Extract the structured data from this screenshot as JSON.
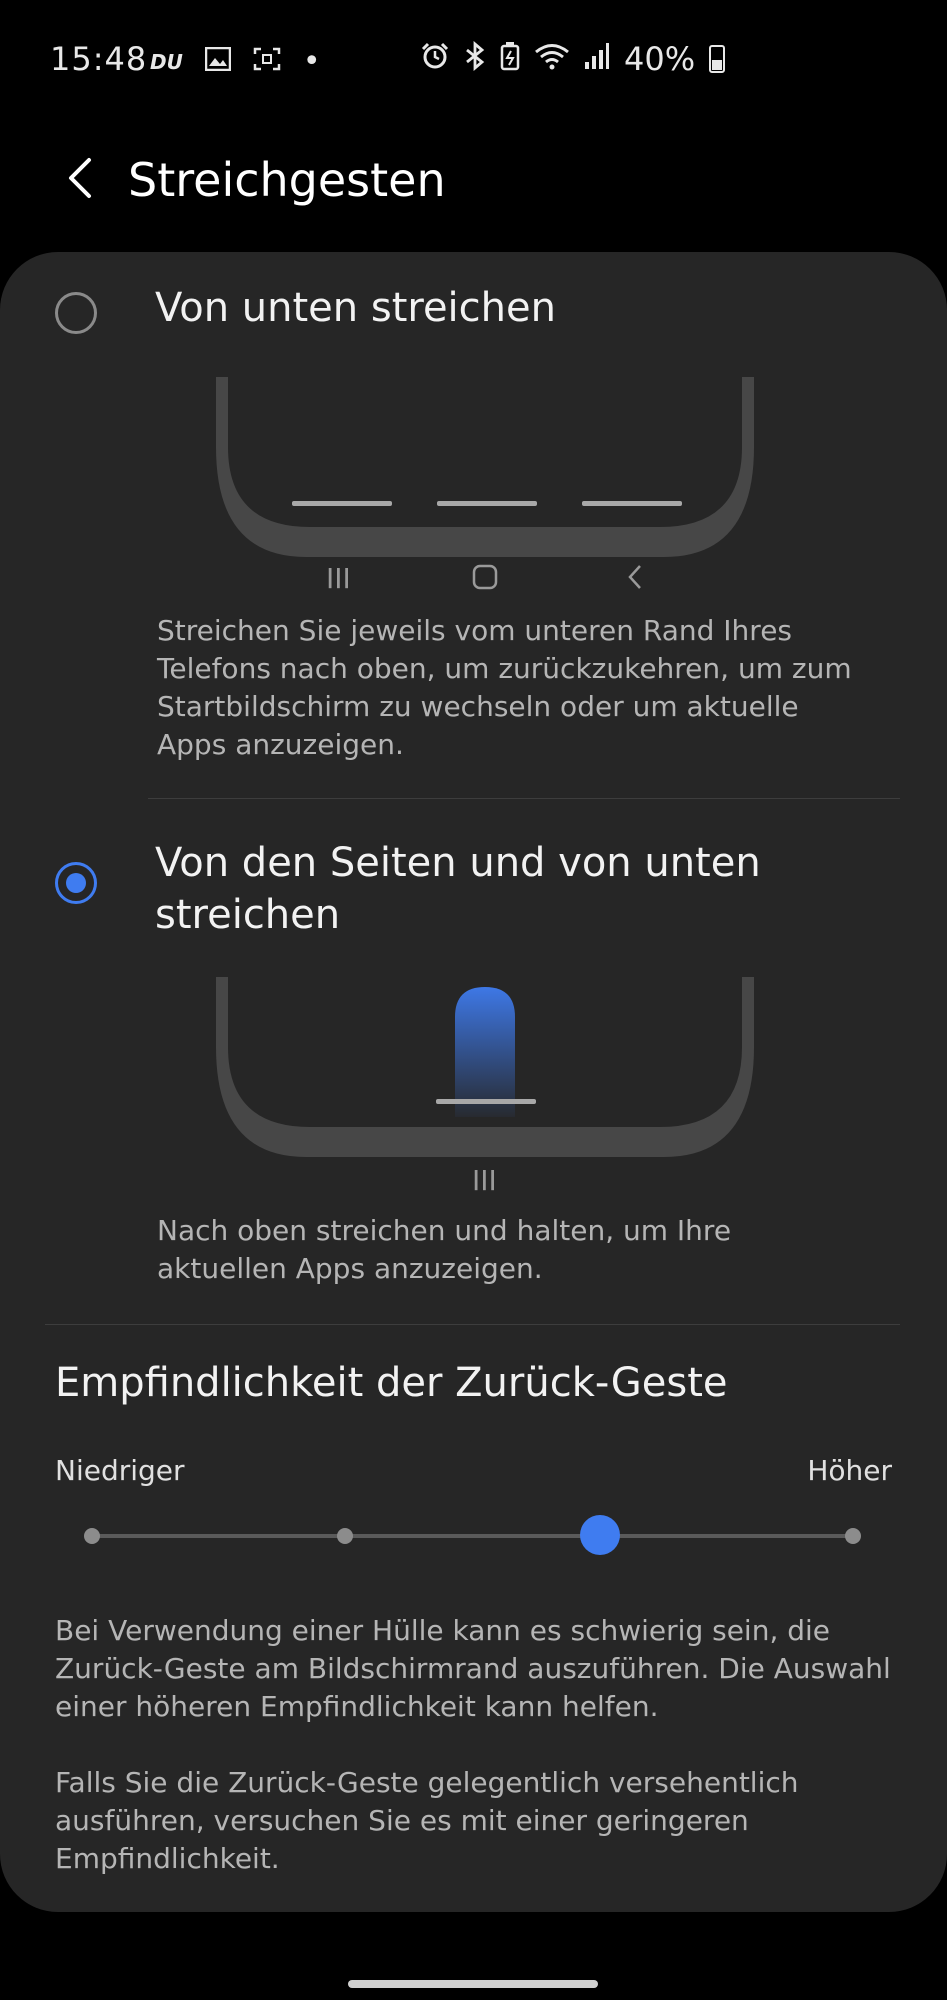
{
  "status_bar": {
    "time": "15:48",
    "left_icons": [
      "du-carrier-icon",
      "image-icon",
      "screenshot-icon",
      "dot-icon"
    ],
    "right_icons": [
      "alarm-icon",
      "bluetooth-icon",
      "battery-saver-icon",
      "wifi-icon",
      "signal-icon"
    ],
    "battery": "40%"
  },
  "header": {
    "back_icon": "chevron-left-icon",
    "title": "Streichgesten"
  },
  "options": [
    {
      "title": "Von unten streichen",
      "selected": false,
      "nav_glyphs": [
        "III",
        "▢",
        "‹"
      ],
      "description": "Streichen Sie jeweils vom unteren Rand Ihres Telefons nach oben, um zurückzukehren, um zum Startbildschirm zu wechseln oder um aktuelle Apps anzuzeigen."
    },
    {
      "title": "Von den Seiten und von unten streichen",
      "selected": true,
      "nav_glyphs": [
        "III"
      ],
      "description": "Nach oben streichen und halten, um Ihre aktuellen Apps anzuzeigen."
    }
  ],
  "sensitivity": {
    "title": "Empfindlichkeit der Zurück-Geste",
    "low_label": "Niedriger",
    "high_label": "Höher",
    "steps": 4,
    "selected_step": 3
  },
  "help": {
    "para1": "Bei Verwendung einer Hülle kann es schwierig sein, die Zurück-Geste am Bildschirmrand auszuführen. Die Auswahl einer höheren Empfindlichkeit kann helfen.",
    "para2": "Falls Sie die Zurück-Geste gelegentlich versehentlich ausführen, versuchen Sie es mit einer geringeren Empfindlichkeit."
  },
  "colors": {
    "accent": "#3f7cf0",
    "card": "#262626",
    "background": "#000000"
  }
}
